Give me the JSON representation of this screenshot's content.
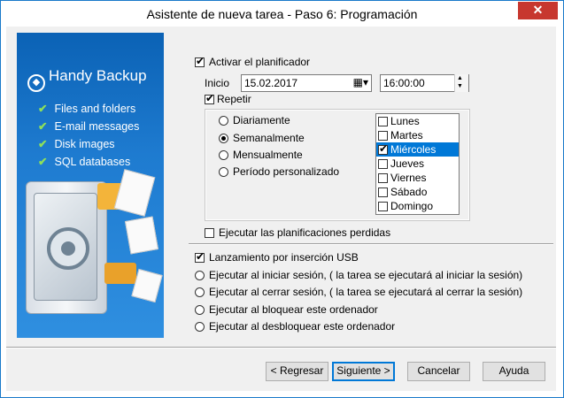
{
  "window": {
    "title": "Asistente de nueva tarea - Paso 6: Programación",
    "close_glyph": "✕"
  },
  "banner": {
    "brand": "Handy Backup",
    "features": [
      "Files and folders",
      "E-mail messages",
      "Disk images",
      "SQL databases"
    ]
  },
  "scheduler": {
    "enable_label": "Activar el planificador",
    "enable_checked": true,
    "start_label": "Inicio",
    "start_date": "15.02.2017",
    "start_time": "16:00:00",
    "repeat_label": "Repetir",
    "repeat_checked": true,
    "frequency_options": [
      "Diariamente",
      "Semanalmente",
      "Mensualmente",
      "Período personalizado"
    ],
    "frequency_selected": "Semanalmente",
    "days": [
      {
        "name": "Lunes",
        "checked": false,
        "selected": false
      },
      {
        "name": "Martes",
        "checked": false,
        "selected": false
      },
      {
        "name": "Miércoles",
        "checked": true,
        "selected": true
      },
      {
        "name": "Jueves",
        "checked": false,
        "selected": false
      },
      {
        "name": "Viernes",
        "checked": false,
        "selected": false
      },
      {
        "name": "Sábado",
        "checked": false,
        "selected": false
      },
      {
        "name": "Domingo",
        "checked": false,
        "selected": false
      }
    ],
    "missed_label": "Ejecutar las planificaciones perdidas",
    "missed_checked": false
  },
  "triggers": {
    "usb_label": "Lanzamiento por inserción USB",
    "usb_checked": true,
    "options": [
      "Ejecutar al iniciar sesión, ( la tarea se ejecutará al iniciar la sesión)",
      "Ejecutar al cerrar sesión, ( la tarea se ejecutará al cerrar la sesión)",
      "Ejecutar al bloquear este ordenador",
      "Ejecutar al desbloquear este ordenador"
    ]
  },
  "buttons": {
    "back": "< Regresar",
    "next": "Siguiente >",
    "cancel": "Cancelar",
    "help": "Ayuda"
  }
}
